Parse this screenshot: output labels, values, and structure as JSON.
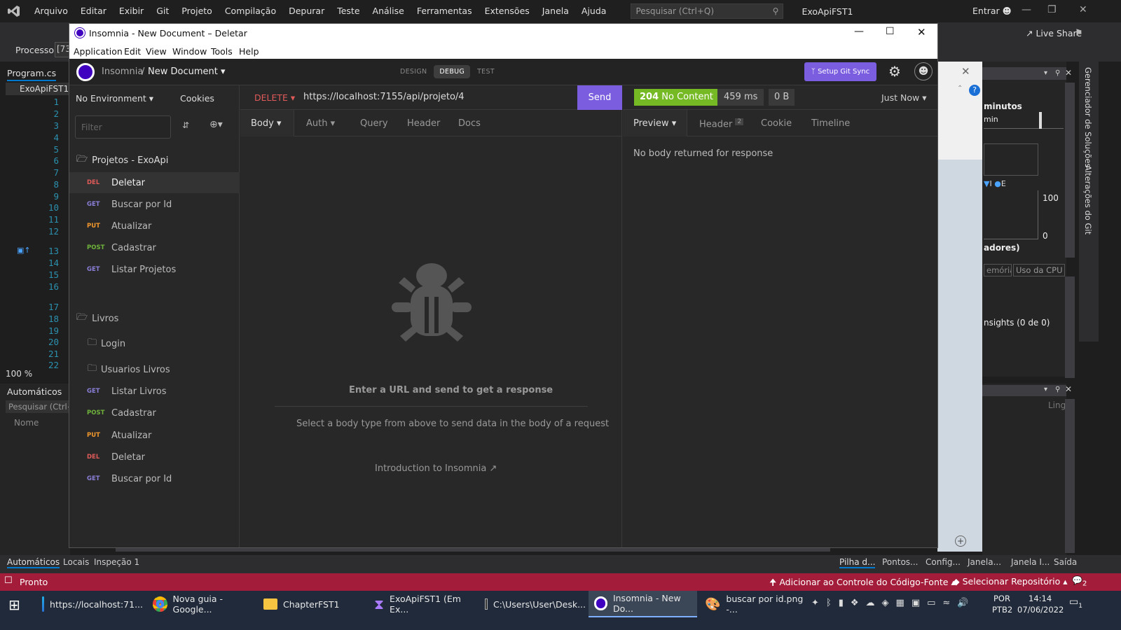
{
  "vs": {
    "menu": [
      "Arquivo",
      "Editar",
      "Exibir",
      "Git",
      "Projeto",
      "Compilação",
      "Depurar",
      "Teste",
      "Análise",
      "Ferramentas",
      "Extensões",
      "Janela",
      "Ajuda"
    ],
    "search_placeholder": "Pesquisar (Ctrl+Q)",
    "solution_name": "ExoApiFST1",
    "signin": "Entrar",
    "live_share": "Live Share",
    "process_label": "Processo:",
    "process_value": "[73",
    "editor_tab": "Program.cs",
    "nav_project": "ExoApiFST1",
    "line_numbers": [
      "1",
      "2",
      "3",
      "4",
      "5",
      "6",
      "7",
      "8",
      "9",
      "10",
      "11",
      "12",
      "13",
      "14",
      "15",
      "16",
      "17",
      "18",
      "19",
      "20",
      "21",
      "22"
    ],
    "zoom": "100 %",
    "auto_panel_title": "Automáticos",
    "auto_search": "Pesquisar (Ctrl+E",
    "auto_column": "Nome",
    "diag": {
      "minutes_label": "minutos",
      "min_label": "min",
      "max_value": "100",
      "min_value": "0",
      "section_label": "adores)",
      "tab_memory": "emória",
      "tab_cpu": "Uso da CPU",
      "insights": "nsights (0 de 0)",
      "lang_col": "Ling"
    },
    "vertical_tabs": [
      "Gerenciador de Soluções",
      "Alterações do Git"
    ],
    "bottom_tabs_left": [
      "Automáticos",
      "Locais",
      "Inspeção 1"
    ],
    "bottom_tabs_right": [
      "Pilha d...",
      "Pontos...",
      "Config...",
      "Janela...",
      "Janela I...",
      "Saída"
    ],
    "status": {
      "ready": "Pronto",
      "add_source_control": "Adicionar ao Controle do Código-Fonte",
      "select_repo": "Selecionar Repositório",
      "notifications": "2"
    }
  },
  "insomnia": {
    "window_title": "Insomnia - New Document – Deletar",
    "menu": [
      "Application",
      "Edit",
      "View",
      "Window",
      "Tools",
      "Help"
    ],
    "breadcrumb_root": "Insomnia",
    "breadcrumb_sep": "/",
    "document_name": "New Document",
    "mode_tabs": [
      "DESIGN",
      "DEBUG",
      "TEST"
    ],
    "active_mode": "DEBUG",
    "git_sync": "Setup Git Sync",
    "environment": "No Environment",
    "cookies": "Cookies",
    "filter_placeholder": "Filter",
    "folders": {
      "projetos": "Projetos - ExoApi",
      "livros": "Livros",
      "login": "Login",
      "usuarios_livros": "Usuarios Livros"
    },
    "projetos_requests": [
      {
        "method": "DEL",
        "name": "Deletar"
      },
      {
        "method": "GET",
        "name": "Buscar por Id"
      },
      {
        "method": "PUT",
        "name": "Atualizar"
      },
      {
        "method": "POST",
        "name": "Cadastrar"
      },
      {
        "method": "GET",
        "name": "Listar Projetos"
      }
    ],
    "livros_requests": [
      {
        "method": "GET",
        "name": "Listar Livros"
      },
      {
        "method": "POST",
        "name": "Cadastrar"
      },
      {
        "method": "PUT",
        "name": "Atualizar"
      },
      {
        "method": "DEL",
        "name": "Deletar"
      },
      {
        "method": "GET",
        "name": "Buscar por Id"
      }
    ],
    "request": {
      "method": "DELETE",
      "url": "https://localhost:7155/api/projeto/4",
      "send": "Send",
      "tabs": [
        "Body",
        "Auth",
        "Query",
        "Header",
        "Docs"
      ],
      "empty_title": "Enter a URL and send to get a response",
      "empty_hint": "Select a body type from above to send data in the body of a request",
      "intro_link": "Introduction to Insomnia"
    },
    "response": {
      "status_code": "204",
      "status_text": "No Content",
      "time": "459 ms",
      "size": "0 B",
      "when": "Just Now",
      "tabs": [
        "Preview",
        "Header",
        "Cookie",
        "Timeline"
      ],
      "header_count": "2",
      "body_message": "No body returned for response"
    }
  },
  "taskbar": {
    "items": [
      {
        "icon": "edge-icon",
        "label": "https://localhost:71..."
      },
      {
        "icon": "chrome-icon",
        "label": "Nova guia - Google..."
      },
      {
        "icon": "folder-icon",
        "label": "ChapterFST1"
      },
      {
        "icon": "visual-studio-icon",
        "label": "ExoApiFST1 (Em Ex..."
      },
      {
        "icon": "terminal-icon",
        "label": "C:\\Users\\User\\Desk..."
      },
      {
        "icon": "insomnia-icon",
        "label": "Insomnia - New Do..."
      },
      {
        "icon": "paint-icon",
        "label": "buscar por id.png -..."
      }
    ],
    "lang_top": "POR",
    "lang_bottom": "PTB2",
    "time": "14:14",
    "date": "07/06/2022",
    "notification_count": "1"
  },
  "colors": {
    "accent_purple": "#7b5ee0",
    "status_success": "#75ba24",
    "vs_statusbar": "#a31d3a",
    "method_delete": "#e15a5a",
    "method_get": "#8a7fd8",
    "method_put": "#f0972d",
    "method_post": "#6fb33b"
  }
}
